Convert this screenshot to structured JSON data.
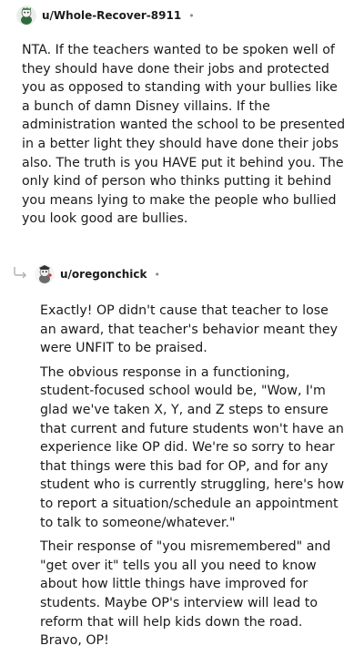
{
  "comments": [
    {
      "username": "u/Whole-Recover-8911",
      "separator": "•",
      "body": "NTA. If the teachers wanted to be spoken well of they should have done their jobs and protected you as opposed to standing with your bullies like a bunch of damn Disney villains. If the administration wanted the school to be presented in a better light they should have done their jobs also. The truth is you HAVE put it behind you. The only kind of person who thinks putting it behind you means lying to make the people who bullied you look good are bullies."
    },
    {
      "username": "u/oregonchick",
      "separator": "•",
      "paragraphs": [
        "Exactly! OP didn't cause that teacher to lose an award, that teacher's behavior meant they were UNFIT to be praised.",
        "The obvious response in a functioning, student-focused school would be, \"Wow, I'm glad we've taken X, Y, and Z steps to ensure that current and future students won't have an experience like OP did. We're so sorry to hear that things were this bad for OP, and for any student who is currently struggling, here's how to report a situation/schedule an appointment to talk to someone/whatever.\"",
        "Their response of \"you misremembered\" and \"get over it\" tells you all you need to know about how little things have improved for students. Maybe OP's interview will lead to reform that will help kids down the road. Bravo, OP!"
      ]
    }
  ],
  "icons": {
    "avatar_1": "avatar-icon",
    "avatar_2": "avatar-icon",
    "reply_thread": "reply-arrow-icon"
  }
}
